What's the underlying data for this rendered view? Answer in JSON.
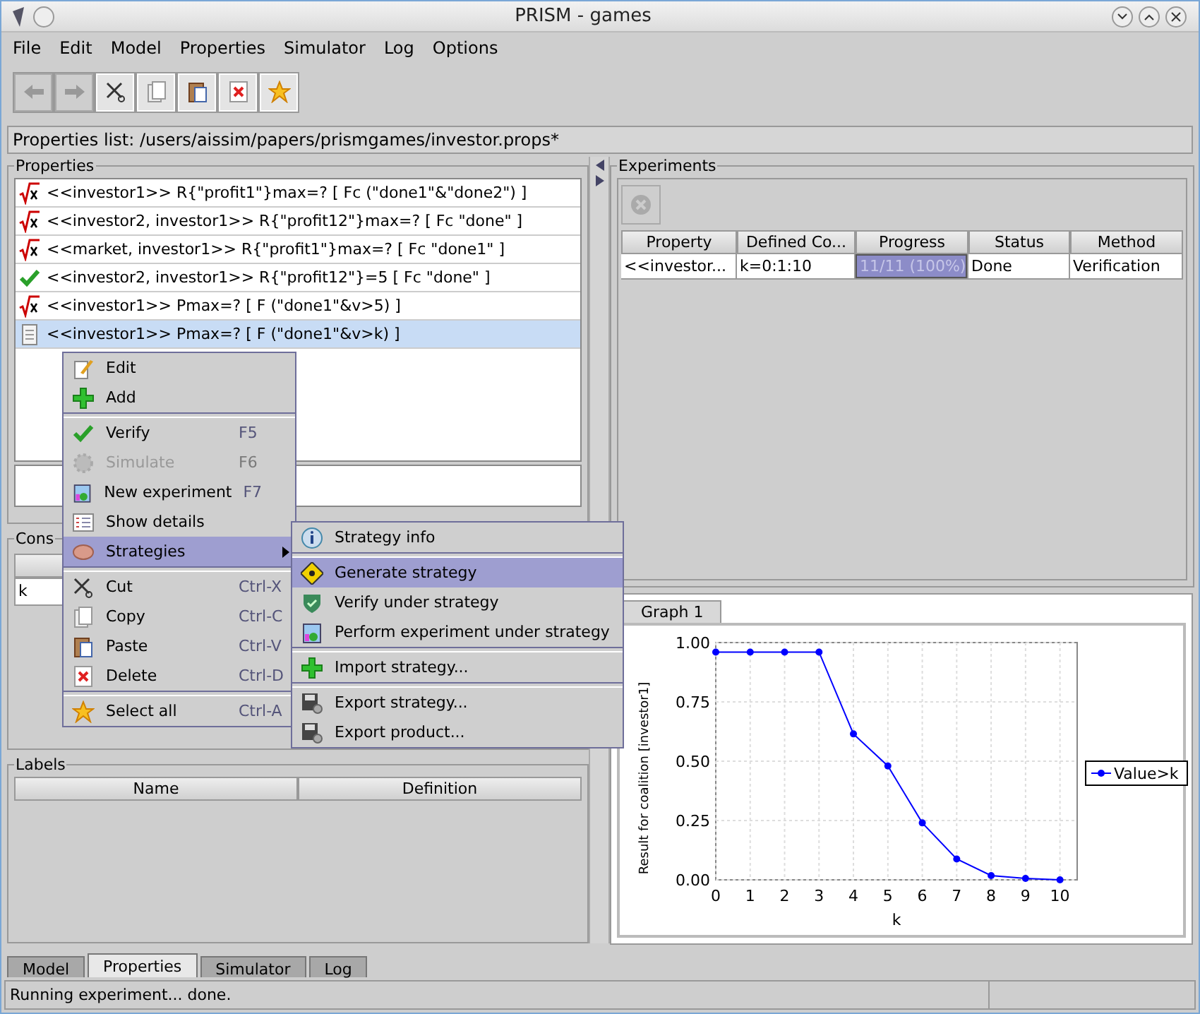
{
  "window": {
    "title": "PRISM - games"
  },
  "menu_bar": [
    "File",
    "Edit",
    "Model",
    "Properties",
    "Simulator",
    "Log",
    "Options"
  ],
  "toolbar": [
    {
      "disabled": true
    },
    {
      "disabled": true
    },
    {
      "disabled": false
    },
    {
      "disabled": false
    },
    {
      "disabled": false
    },
    {
      "disabled": false
    },
    {
      "disabled": false
    }
  ],
  "path_bar": "Properties list:  /users/aissim/papers/prismgames/investor.props*",
  "properties": {
    "title": "Properties",
    "items": [
      {
        "text": "<<investor1>> R{\"profit1\"}max=? [ Fc (\"done1\"&\"done2\") ]",
        "kind": "unknown",
        "selected": false
      },
      {
        "text": "<<investor2, investor1>> R{\"profit12\"}max=? [ Fc \"done\" ]",
        "kind": "unknown",
        "selected": false
      },
      {
        "text": "<<market, investor1>> R{\"profit1\"}max=? [ Fc \"done1\" ]",
        "kind": "unknown",
        "selected": false
      },
      {
        "text": "<<investor2, investor1>> R{\"profit12\"}=5 [ Fc \"done\" ]",
        "kind": "verified",
        "selected": false
      },
      {
        "text": "<<investor1>> Pmax=? [ F (\"done1\"&v>5) ]",
        "kind": "unknown",
        "selected": false
      },
      {
        "text": "<<investor1>> Pmax=? [ F (\"done1\"&v>k) ]",
        "kind": "plain",
        "selected": true
      }
    ]
  },
  "constants": {
    "title": "Cons",
    "rows": [
      "k"
    ]
  },
  "labels": {
    "title": "Labels",
    "columns": [
      "Name",
      "Definition"
    ]
  },
  "experiments": {
    "title": "Experiments",
    "stop_button": {
      "disabled": true
    },
    "columns": [
      "Property",
      "Defined Co...",
      "Progress",
      "Status",
      "Method"
    ],
    "rows": [
      {
        "property": "<<investor...",
        "constants": "k=0:1:10",
        "progress": "11/11 (100%)",
        "level": 1,
        "status": "Done",
        "method": "Verification"
      }
    ]
  },
  "graph": {
    "tab": "Graph 1",
    "chart_data": {
      "type": "line",
      "xlabel": "k",
      "ylabel": "Result for coalition [investor1]",
      "x": [
        0,
        1,
        2,
        3,
        4,
        5,
        6,
        7,
        8,
        9,
        10
      ],
      "series": [
        {
          "name": "Value>k",
          "color": "#0000ff",
          "marker": "circle",
          "values": [
            0.96,
            0.96,
            0.96,
            0.96,
            0.615,
            0.48,
            0.24,
            0.088,
            0.018,
            0.006,
            0.0
          ]
        }
      ],
      "grid": true,
      "xlim": [
        0,
        10.5
      ],
      "ylim": [
        0,
        1
      ],
      "xticks": [
        0,
        1,
        2,
        3,
        4,
        5,
        6,
        7,
        8,
        9,
        10
      ],
      "yticks": [
        {
          "value": 0,
          "label": "0.00"
        },
        {
          "value": 0.25,
          "label": "0.25"
        },
        {
          "value": 0.5,
          "label": "0.50"
        },
        {
          "value": 0.75,
          "label": "0.75"
        },
        {
          "value": 1,
          "label": "1.00"
        }
      ]
    }
  },
  "context_menu": {
    "groups": [
      [
        {
          "label": "Edit",
          "disabled": false,
          "selected": false,
          "submenu": false
        },
        {
          "label": "Add",
          "disabled": false,
          "selected": false,
          "submenu": false
        }
      ],
      [
        {
          "label": "Verify",
          "shortcut": "F5",
          "disabled": false,
          "selected": false,
          "submenu": false
        },
        {
          "label": "Simulate",
          "shortcut": "F6",
          "disabled": true,
          "selected": false,
          "submenu": false
        },
        {
          "label": "New experiment",
          "shortcut": "F7",
          "disabled": false,
          "selected": false,
          "submenu": false
        },
        {
          "label": "Show details",
          "disabled": false,
          "selected": false,
          "submenu": false
        },
        {
          "label": "Strategies",
          "disabled": false,
          "selected": true,
          "submenu": true
        }
      ],
      [
        {
          "label": "Cut",
          "shortcut": "Ctrl-X",
          "disabled": false,
          "selected": false,
          "submenu": false
        },
        {
          "label": "Copy",
          "shortcut": "Ctrl-C",
          "disabled": false,
          "selected": false,
          "submenu": false
        },
        {
          "label": "Paste",
          "shortcut": "Ctrl-V",
          "disabled": false,
          "selected": false,
          "submenu": false
        },
        {
          "label": "Delete",
          "shortcut": "Ctrl-D",
          "disabled": false,
          "selected": false,
          "submenu": false
        }
      ],
      [
        {
          "label": "Select all",
          "shortcut": "Ctrl-A",
          "disabled": false,
          "selected": false,
          "submenu": false
        }
      ]
    ]
  },
  "submenu": {
    "groups": [
      [
        {
          "label": "Strategy info",
          "selected": false
        }
      ],
      [
        {
          "label": "Generate strategy",
          "selected": true
        },
        {
          "label": "Verify under strategy",
          "selected": false
        },
        {
          "label": "Perform experiment under strategy",
          "selected": false
        }
      ],
      [
        {
          "label": "Import strategy...",
          "selected": false
        }
      ],
      [
        {
          "label": "Export strategy...",
          "selected": false
        },
        {
          "label": "Export product...",
          "selected": false
        }
      ]
    ]
  },
  "bottom_tabs": [
    {
      "label": "Model",
      "selected": false
    },
    {
      "label": "Properties",
      "selected": true
    },
    {
      "label": "Simulator",
      "selected": false
    },
    {
      "label": "Log",
      "selected": false
    }
  ],
  "status_bar": "Running experiment... done."
}
